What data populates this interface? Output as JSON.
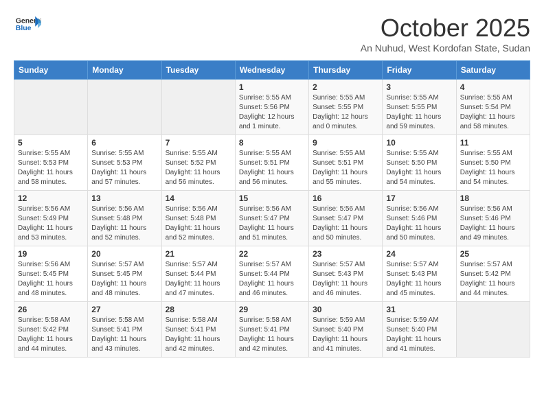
{
  "header": {
    "logo_general": "General",
    "logo_blue": "Blue",
    "month_title": "October 2025",
    "subtitle": "An Nuhud, West Kordofan State, Sudan"
  },
  "days_of_week": [
    "Sunday",
    "Monday",
    "Tuesday",
    "Wednesday",
    "Thursday",
    "Friday",
    "Saturday"
  ],
  "weeks": [
    [
      {
        "day": "",
        "info": ""
      },
      {
        "day": "",
        "info": ""
      },
      {
        "day": "",
        "info": ""
      },
      {
        "day": "1",
        "info": "Sunrise: 5:55 AM\nSunset: 5:56 PM\nDaylight: 12 hours\nand 1 minute."
      },
      {
        "day": "2",
        "info": "Sunrise: 5:55 AM\nSunset: 5:55 PM\nDaylight: 12 hours\nand 0 minutes."
      },
      {
        "day": "3",
        "info": "Sunrise: 5:55 AM\nSunset: 5:55 PM\nDaylight: 11 hours\nand 59 minutes."
      },
      {
        "day": "4",
        "info": "Sunrise: 5:55 AM\nSunset: 5:54 PM\nDaylight: 11 hours\nand 58 minutes."
      }
    ],
    [
      {
        "day": "5",
        "info": "Sunrise: 5:55 AM\nSunset: 5:53 PM\nDaylight: 11 hours\nand 58 minutes."
      },
      {
        "day": "6",
        "info": "Sunrise: 5:55 AM\nSunset: 5:53 PM\nDaylight: 11 hours\nand 57 minutes."
      },
      {
        "day": "7",
        "info": "Sunrise: 5:55 AM\nSunset: 5:52 PM\nDaylight: 11 hours\nand 56 minutes."
      },
      {
        "day": "8",
        "info": "Sunrise: 5:55 AM\nSunset: 5:51 PM\nDaylight: 11 hours\nand 56 minutes."
      },
      {
        "day": "9",
        "info": "Sunrise: 5:55 AM\nSunset: 5:51 PM\nDaylight: 11 hours\nand 55 minutes."
      },
      {
        "day": "10",
        "info": "Sunrise: 5:55 AM\nSunset: 5:50 PM\nDaylight: 11 hours\nand 54 minutes."
      },
      {
        "day": "11",
        "info": "Sunrise: 5:55 AM\nSunset: 5:50 PM\nDaylight: 11 hours\nand 54 minutes."
      }
    ],
    [
      {
        "day": "12",
        "info": "Sunrise: 5:56 AM\nSunset: 5:49 PM\nDaylight: 11 hours\nand 53 minutes."
      },
      {
        "day": "13",
        "info": "Sunrise: 5:56 AM\nSunset: 5:48 PM\nDaylight: 11 hours\nand 52 minutes."
      },
      {
        "day": "14",
        "info": "Sunrise: 5:56 AM\nSunset: 5:48 PM\nDaylight: 11 hours\nand 52 minutes."
      },
      {
        "day": "15",
        "info": "Sunrise: 5:56 AM\nSunset: 5:47 PM\nDaylight: 11 hours\nand 51 minutes."
      },
      {
        "day": "16",
        "info": "Sunrise: 5:56 AM\nSunset: 5:47 PM\nDaylight: 11 hours\nand 50 minutes."
      },
      {
        "day": "17",
        "info": "Sunrise: 5:56 AM\nSunset: 5:46 PM\nDaylight: 11 hours\nand 50 minutes."
      },
      {
        "day": "18",
        "info": "Sunrise: 5:56 AM\nSunset: 5:46 PM\nDaylight: 11 hours\nand 49 minutes."
      }
    ],
    [
      {
        "day": "19",
        "info": "Sunrise: 5:56 AM\nSunset: 5:45 PM\nDaylight: 11 hours\nand 48 minutes."
      },
      {
        "day": "20",
        "info": "Sunrise: 5:57 AM\nSunset: 5:45 PM\nDaylight: 11 hours\nand 48 minutes."
      },
      {
        "day": "21",
        "info": "Sunrise: 5:57 AM\nSunset: 5:44 PM\nDaylight: 11 hours\nand 47 minutes."
      },
      {
        "day": "22",
        "info": "Sunrise: 5:57 AM\nSunset: 5:44 PM\nDaylight: 11 hours\nand 46 minutes."
      },
      {
        "day": "23",
        "info": "Sunrise: 5:57 AM\nSunset: 5:43 PM\nDaylight: 11 hours\nand 46 minutes."
      },
      {
        "day": "24",
        "info": "Sunrise: 5:57 AM\nSunset: 5:43 PM\nDaylight: 11 hours\nand 45 minutes."
      },
      {
        "day": "25",
        "info": "Sunrise: 5:57 AM\nSunset: 5:42 PM\nDaylight: 11 hours\nand 44 minutes."
      }
    ],
    [
      {
        "day": "26",
        "info": "Sunrise: 5:58 AM\nSunset: 5:42 PM\nDaylight: 11 hours\nand 44 minutes."
      },
      {
        "day": "27",
        "info": "Sunrise: 5:58 AM\nSunset: 5:41 PM\nDaylight: 11 hours\nand 43 minutes."
      },
      {
        "day": "28",
        "info": "Sunrise: 5:58 AM\nSunset: 5:41 PM\nDaylight: 11 hours\nand 42 minutes."
      },
      {
        "day": "29",
        "info": "Sunrise: 5:58 AM\nSunset: 5:41 PM\nDaylight: 11 hours\nand 42 minutes."
      },
      {
        "day": "30",
        "info": "Sunrise: 5:59 AM\nSunset: 5:40 PM\nDaylight: 11 hours\nand 41 minutes."
      },
      {
        "day": "31",
        "info": "Sunrise: 5:59 AM\nSunset: 5:40 PM\nDaylight: 11 hours\nand 41 minutes."
      },
      {
        "day": "",
        "info": ""
      }
    ]
  ]
}
